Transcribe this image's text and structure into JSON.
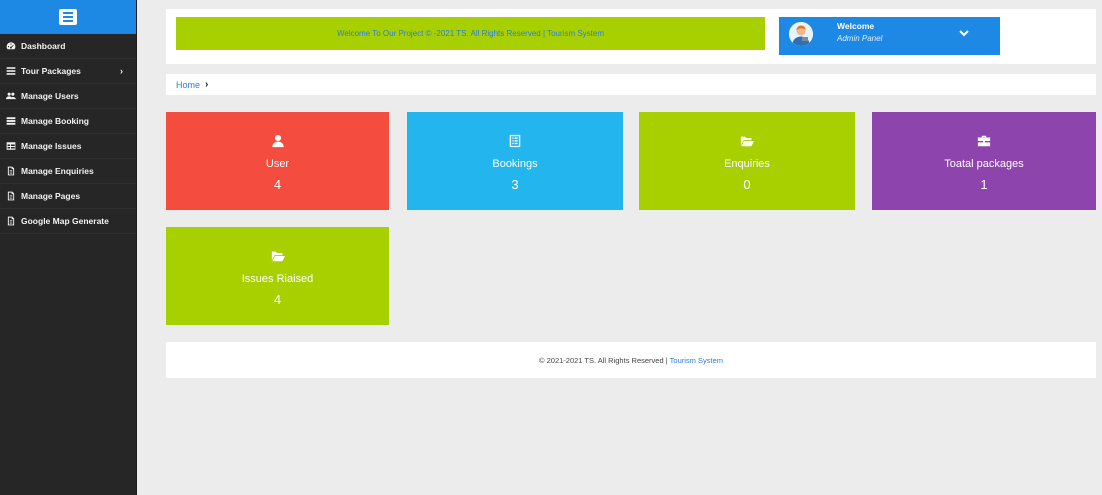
{
  "sidebar": {
    "toggle_icon": "hamburger-icon",
    "items": [
      {
        "label": "Dashboard",
        "icon": "dashboard-icon",
        "has_submenu": false
      },
      {
        "label": "Tour Packages",
        "icon": "list-icon",
        "has_submenu": true
      },
      {
        "label": "Manage Users",
        "icon": "users-icon",
        "has_submenu": false
      },
      {
        "label": "Manage Booking",
        "icon": "list-icon",
        "has_submenu": false
      },
      {
        "label": "Manage Issues",
        "icon": "table-icon",
        "has_submenu": false
      },
      {
        "label": "Manage Enquiries",
        "icon": "file-icon",
        "has_submenu": false
      },
      {
        "label": "Manage Pages",
        "icon": "file-icon",
        "has_submenu": false
      },
      {
        "label": "Google Map Generate",
        "icon": "file-icon",
        "has_submenu": false
      }
    ],
    "submenu_caret": "›"
  },
  "header": {
    "welcome_text": "Welcome To Our Project © -2021 TS. All Rights Reserved | Tourism System",
    "admin": {
      "title": "Welcome",
      "subtitle": "Admin Panel",
      "avatar_icon": "admin-avatar",
      "dropdown_icon": "chevron-down-icon"
    }
  },
  "breadcrumb": {
    "home": "Home",
    "separator": "›"
  },
  "cards": [
    {
      "label": "User",
      "value": "4",
      "icon": "user-icon",
      "color": "#f44c3f"
    },
    {
      "label": "Bookings",
      "value": "3",
      "icon": "list-alt-icon",
      "color": "#22b5ee"
    },
    {
      "label": "Enquiries",
      "value": "0",
      "icon": "folder-open-icon",
      "color": "#a8d000"
    },
    {
      "label": "Toatal packages",
      "value": "1",
      "icon": "briefcase-icon",
      "color": "#8e44ad"
    },
    {
      "label": "Issues Riaised",
      "value": "4",
      "icon": "folder-open-icon",
      "color": "#a8d000"
    }
  ],
  "footer": {
    "text": "© 2021-2021 TS. All Rights Reserved |",
    "link": "Tourism System"
  },
  "colors": {
    "sidebar_bg": "#262626",
    "accent_blue": "#1e88e5",
    "lime": "#a8d000"
  }
}
